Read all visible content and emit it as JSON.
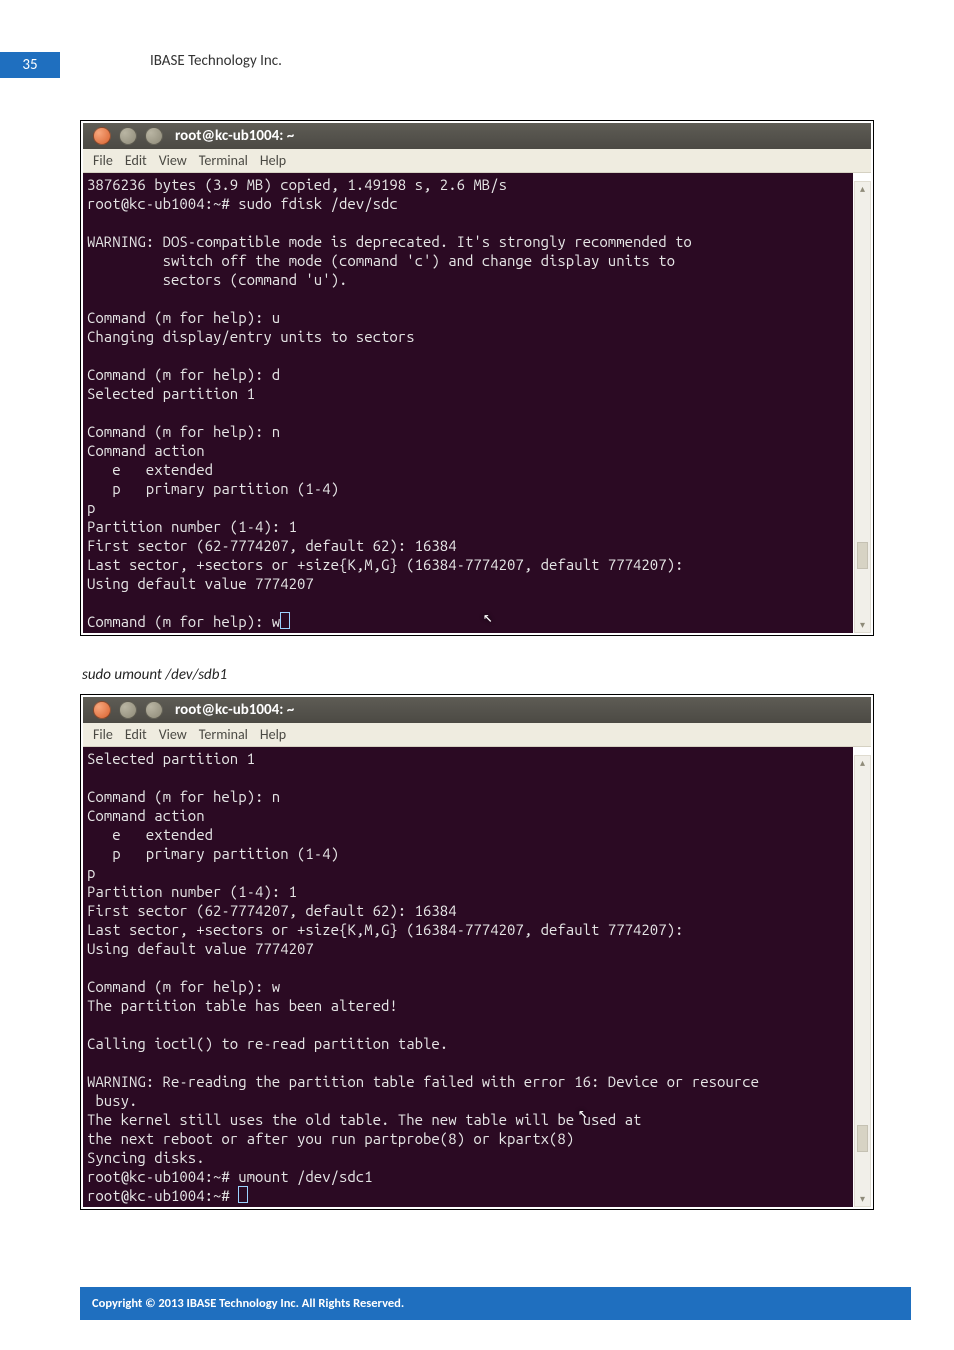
{
  "page": {
    "number": "35",
    "header": "IBASE Technology Inc.",
    "footer": "Copyright © 2013 IBASE Technology Inc. All Rights Reserved."
  },
  "terminal1": {
    "title": "root@kc-ub1004: ~",
    "menu": {
      "file": "File",
      "edit": "Edit",
      "view": "View",
      "terminal": "Terminal",
      "help": "Help"
    },
    "lines": {
      "l00": "3876236 bytes (3.9 MB) copied, 1.49198 s, 2.6 MB/s",
      "l01": "root@kc-ub1004:~# sudo fdisk /dev/sdc",
      "l02": "",
      "l03": "WARNING: DOS-compatible mode is deprecated. It's strongly recommended to",
      "l04": "         switch off the mode (command 'c') and change display units to",
      "l05": "         sectors (command 'u').",
      "l06": "",
      "l07": "Command (m for help): u",
      "l08": "Changing display/entry units to sectors",
      "l09": "",
      "l10": "Command (m for help): d",
      "l11": "Selected partition 1",
      "l12": "",
      "l13": "Command (m for help): n",
      "l14": "Command action",
      "l15": "   e   extended",
      "l16": "   p   primary partition (1-4)",
      "l17": "p",
      "l18": "Partition number (1-4): 1",
      "l19": "First sector (62-7774207, default 62): 16384",
      "l20": "Last sector, +sectors or +size{K,M,G} (16384-7774207, default 7774207):",
      "l21": "Using default value 7774207",
      "l22": "",
      "l23": "Command (m for help): w"
    }
  },
  "caption": "sudo umount /dev/sdb1",
  "terminal2": {
    "title": "root@kc-ub1004: ~",
    "menu": {
      "file": "File",
      "edit": "Edit",
      "view": "View",
      "terminal": "Terminal",
      "help": "Help"
    },
    "lines": {
      "l00": "Selected partition 1",
      "l01": "",
      "l02": "Command (m for help): n",
      "l03": "Command action",
      "l04": "   e   extended",
      "l05": "   p   primary partition (1-4)",
      "l06": "p",
      "l07": "Partition number (1-4): 1",
      "l08": "First sector (62-7774207, default 62): 16384",
      "l09": "Last sector, +sectors or +size{K,M,G} (16384-7774207, default 7774207):",
      "l10": "Using default value 7774207",
      "l11": "",
      "l12": "Command (m for help): w",
      "l13": "The partition table has been altered!",
      "l14": "",
      "l15": "Calling ioctl() to re-read partition table.",
      "l16": "",
      "l17": "WARNING: Re-reading the partition table failed with error 16: Device or resource",
      "l18": " busy.",
      "l19": "The kernel still uses the old table. The new table will be used at",
      "l20": "the next reboot or after you run partprobe(8) or kpartx(8)",
      "l21": "Syncing disks.",
      "l22": "root@kc-ub1004:~# umount /dev/sdc1",
      "l23": "root@kc-ub1004:~# "
    }
  }
}
